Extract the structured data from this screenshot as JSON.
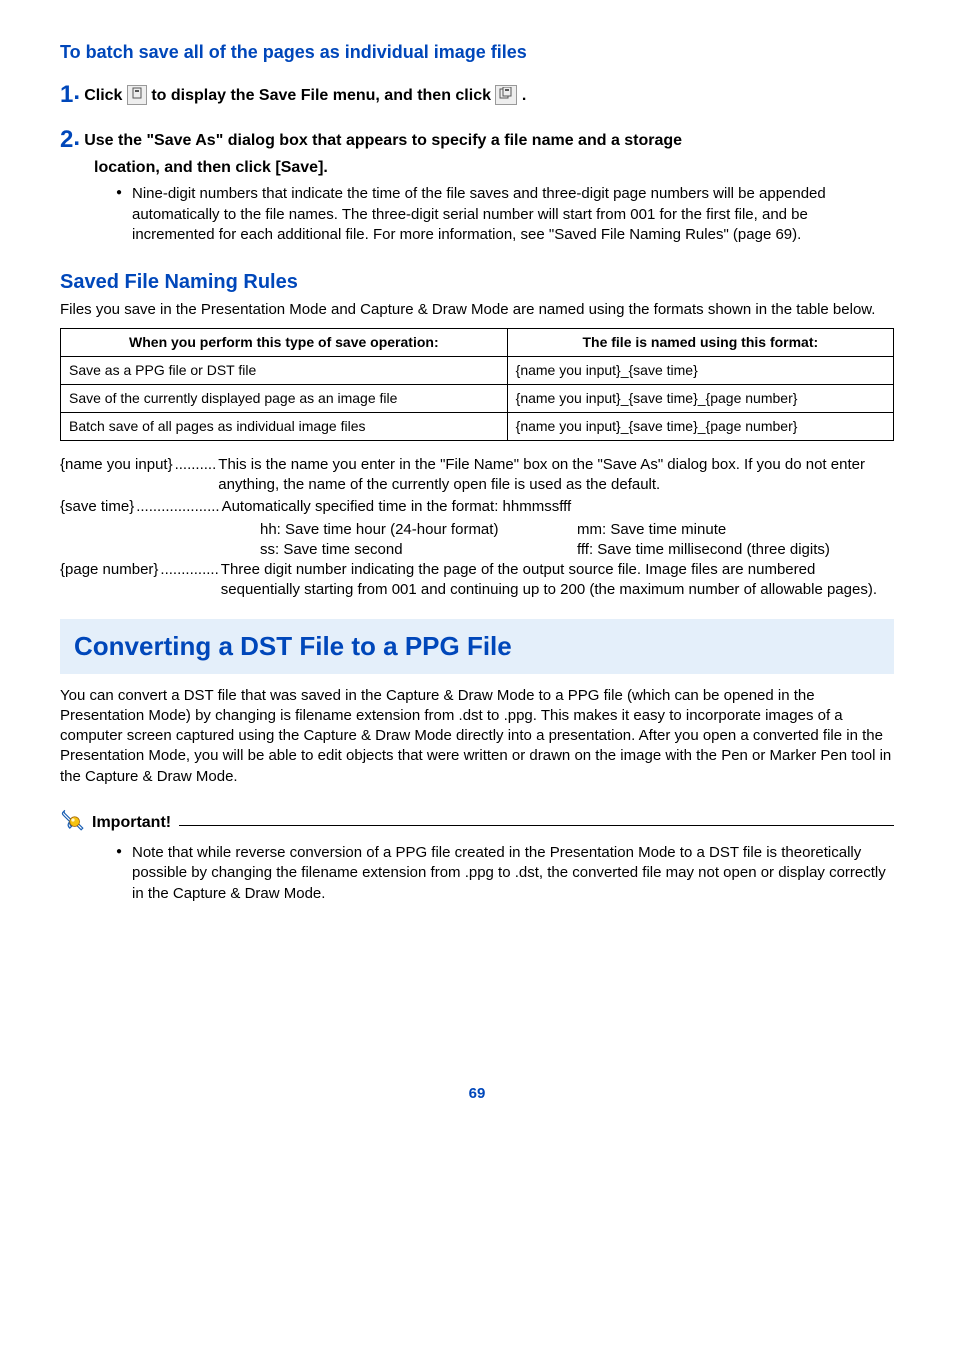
{
  "section1": {
    "title": "To batch save all of the pages as individual image files",
    "step1_pre": "Click ",
    "step1_mid": " to display the Save File menu, and then click ",
    "step1_post": ".",
    "step2_line1": "Use the \"Save As\" dialog box that appears to specify a file name and a storage",
    "step2_line2": "location, and then click [Save].",
    "bullet": "Nine-digit numbers that indicate the time of the file saves and three-digit page numbers will be appended automatically to the file names. The three-digit serial number will start from 001 for the first file, and be incremented for each additional file. For more information, see \"Saved File Naming Rules\" (page 69)."
  },
  "section2": {
    "title": "Saved File Naming Rules",
    "intro": "Files you save in the Presentation Mode and Capture & Draw Mode are named using the formats shown in the table below.",
    "th1": "When you perform this type of save operation:",
    "th2": "The file is named using this format:",
    "rows": [
      {
        "op": "Save as a PPG file or DST file",
        "fmt": "{name you input}_{save time}"
      },
      {
        "op": "Save of the currently displayed page as an image file",
        "fmt": "{name you input}_{save time}_{page number}"
      },
      {
        "op": "Batch save of all pages as individual image files",
        "fmt": "{name you input}_{save time}_{page number}"
      }
    ],
    "defs": {
      "name_term": "{name you input}",
      "name_dots": "..........",
      "name_body": "This is the name you enter in the \"File Name\" box on the \"Save As\" dialog box. If you do not enter anything, the name of the currently open file is used as the default.",
      "save_term": "{save time}",
      "save_dots": "....................",
      "save_body": "Automatically specified time in the format: hhmmssfff",
      "save_hh": "hh: Save time hour (24-hour format)",
      "save_mm": "mm: Save time minute",
      "save_ss": "ss: Save time second",
      "save_fff": "fff: Save time millisecond (three digits)",
      "page_term": "{page number}",
      "page_dots": "..............",
      "page_body": "Three digit number indicating the page of the output source file. Image files are numbered sequentially starting from 001 and continuing up to 200 (the maximum number of allowable pages)."
    }
  },
  "section3": {
    "title": "Converting a DST File to a PPG File",
    "body": "You can convert a DST file that was saved in the Capture & Draw Mode to a PPG file (which can be opened in the Presentation Mode) by changing is filename extension from .dst to .ppg. This makes it easy to incorporate images of a computer screen captured using the Capture & Draw Mode directly into a presentation. After you open a converted file in the Presentation Mode, you will be able to edit objects that were written or drawn on the image with the Pen or Marker Pen tool in the Capture & Draw Mode.",
    "important_label": "Important!",
    "important_bullet": "Note that while reverse conversion of a PPG file created in the Presentation Mode to a DST file is theoretically possible by changing the filename extension from .ppg to .dst, the converted file may not open or display correctly in the Capture & Draw Mode."
  },
  "page_number": "69"
}
